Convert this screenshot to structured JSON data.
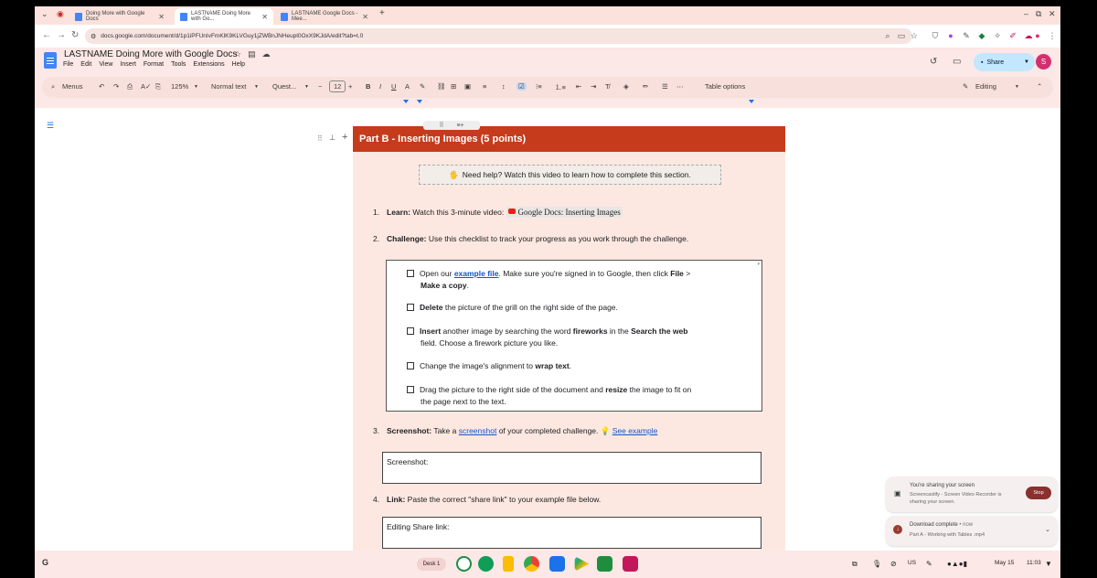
{
  "tabs": [
    {
      "label": "Doing More with Google Docs"
    },
    {
      "label": "LASTNAME Doing More with Go..."
    },
    {
      "label": "LASTNAME Google Docs - Mee..."
    }
  ],
  "url": "docs.google.com/document/d/1p1iPFUnIvFmKlK9KLVGuy1jZWBnJNHeupl0OxX9KJdA/edit?tab=t.0",
  "doc": {
    "title": "LASTNAME Doing More with Google Docs",
    "menu": [
      "File",
      "Edit",
      "View",
      "Insert",
      "Format",
      "Tools",
      "Extensions",
      "Help"
    ],
    "share_label": "Share",
    "avatar_letter": "S"
  },
  "format_toolbar": {
    "menus_label": "Menus",
    "zoom": "125%",
    "style": "Normal text",
    "font": "Quest...",
    "font_size": "12",
    "table_options": "Table options",
    "editing": "Editing"
  },
  "content": {
    "section_title": "Part B - Inserting Images (5 points)",
    "help_text": "Need help? Watch this video to learn how to complete this section.",
    "help_emoji": "🖐",
    "item1": {
      "num": "1.",
      "label": "Learn:",
      "text": " Watch this 3-minute video: ",
      "link": "Google Docs: Inserting Images"
    },
    "item2": {
      "num": "2.",
      "label": "Challenge:",
      "text": " Use this checklist to track your progress as you work through the challenge."
    },
    "checklist": [
      {
        "pre": "Open our ",
        "link": "example file",
        "mid": ". Make sure you're signed in to Google, then click ",
        "b1": "File",
        "post": " >",
        "line2_b": "Make a copy",
        "line2": "."
      },
      {
        "b1": "Delete",
        "post": " the picture of the grill on the right side of the page."
      },
      {
        "b1": "Insert",
        "mid": " another image by searching the word ",
        "b2": "fireworks",
        "mid2": " in the ",
        "b3": "Search the web",
        "line2": "field. Choose a firework picture you like."
      },
      {
        "pre": "Change the image's alignment to ",
        "b1": "wrap text",
        "post": "."
      },
      {
        "pre": "Drag the picture to the right side of the document and ",
        "b1": "resize",
        "post": " the image to fit on",
        "line2": "the page next to the text."
      }
    ],
    "item3": {
      "num": "3.",
      "label": "Screenshot:",
      "text": " Take a ",
      "link": "screenshot",
      "text2": " of your completed challenge. ",
      "emoji": "💡",
      "link2": "See example"
    },
    "screenshot_label": "Screenshot:",
    "item4": {
      "num": "4.",
      "label": "Link:",
      "text": " Paste the correct \"share link\" to your example file below."
    },
    "share_link_label": "Editing Share link:"
  },
  "notifications": {
    "sharing": {
      "title": "You're sharing your screen",
      "body": "Screencastify - Screen Video Recorder is sharing your screen.",
      "stop": "Stop"
    },
    "download": {
      "title": "Download complete",
      "time": "• now",
      "file": "Part A - Working with Tables .mp4"
    }
  },
  "shelf": {
    "desk": "Desk 1",
    "locale": "US",
    "date": "May 15",
    "time": "11:03"
  },
  "colors": {
    "header_red": "#c53b1b",
    "page_tint": "#fde8e1",
    "link_blue": "#1155cc",
    "share_blue": "#c2e7ff"
  }
}
